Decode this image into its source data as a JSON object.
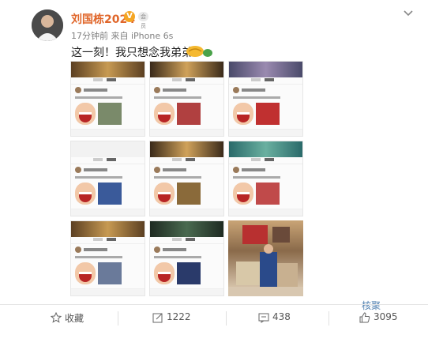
{
  "post": {
    "username": "刘国栋2024",
    "verified_icon": "verified-badge-icon",
    "member_badge": "会员",
    "time": "17分钟前",
    "source": "来自 iPhone 6s",
    "text": "这一刻！我只想念我弟弟！",
    "emojis": [
      "handshake-icon",
      "green-emoji-icon"
    ]
  },
  "grid": {
    "tiles": [
      {
        "kind": "screenshot",
        "band": "#7a5a3a"
      },
      {
        "kind": "screenshot",
        "band": "#5a4632"
      },
      {
        "kind": "screenshot",
        "band": "#6a5f7a"
      },
      {
        "kind": "screenshot",
        "band": "#7a5a3a"
      },
      {
        "kind": "screenshot",
        "band": "#5a4632"
      },
      {
        "kind": "screenshot",
        "band": "#6a5f7a"
      },
      {
        "kind": "screenshot",
        "band": "#7a5a3a"
      },
      {
        "kind": "screenshot",
        "band": "#2e3b33"
      },
      {
        "kind": "photo"
      }
    ]
  },
  "actions": {
    "favorite_label": "收藏",
    "repost_count": "1222",
    "comment_count": "438",
    "like_count": "3095"
  },
  "watermark": "核聚"
}
